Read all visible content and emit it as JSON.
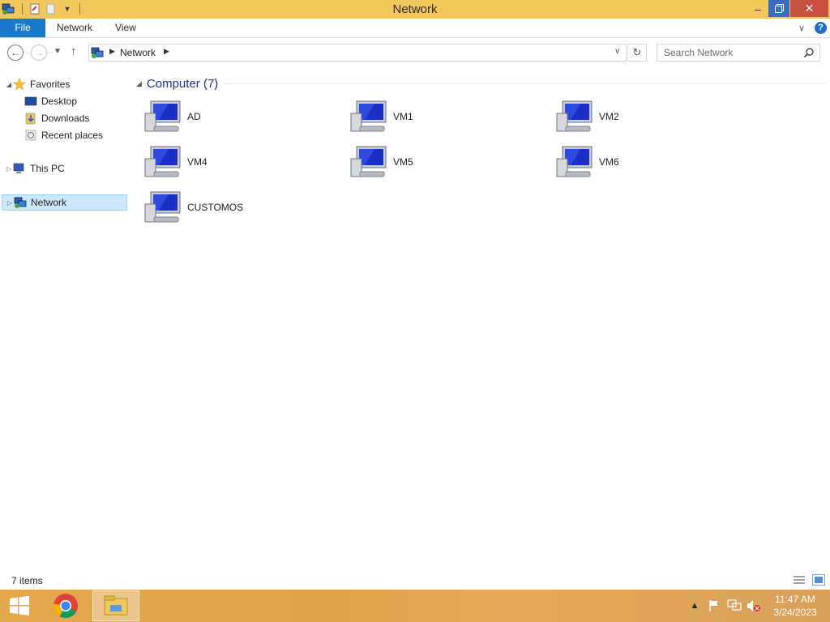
{
  "window": {
    "title": "Network",
    "icon": "network-icon",
    "controls": {
      "minimize": "minimize-icon",
      "maximize": "restore-icon",
      "close": "close-icon"
    }
  },
  "ribbon": {
    "tabs": [
      {
        "label": "File"
      },
      {
        "label": "Network"
      },
      {
        "label": "View"
      }
    ]
  },
  "address": {
    "path": "Network",
    "search_placeholder": "Search Network"
  },
  "sidebar": {
    "favorites": {
      "label": "Favorites",
      "items": [
        {
          "label": "Desktop",
          "icon": "desktop-icon"
        },
        {
          "label": "Downloads",
          "icon": "downloads-icon"
        },
        {
          "label": "Recent places",
          "icon": "recent-places-icon"
        }
      ]
    },
    "this_pc": {
      "label": "This PC",
      "icon": "computer-icon"
    },
    "network": {
      "label": "Network",
      "icon": "network-icon",
      "selected": true
    }
  },
  "main": {
    "group_label": "Computer (7)",
    "computers": [
      {
        "name": "AD"
      },
      {
        "name": "VM1"
      },
      {
        "name": "VM2"
      },
      {
        "name": "VM4"
      },
      {
        "name": "VM5"
      },
      {
        "name": "VM6"
      },
      {
        "name": "CUSTOMOS"
      }
    ]
  },
  "status": {
    "item_count": "7 items"
  },
  "taskbar": {
    "apps": [
      "start-button",
      "chrome-icon",
      "file-explorer-icon"
    ],
    "clock": {
      "time": "11:47 AM",
      "date": "3/24/2023"
    }
  },
  "colors": {
    "title_bar": "#f2c85b",
    "file_tab": "#1979ca",
    "group_header": "#1e3287",
    "selection": "#cce8ff",
    "close_button": "#c7503e",
    "taskbar": "#e4a84f"
  }
}
